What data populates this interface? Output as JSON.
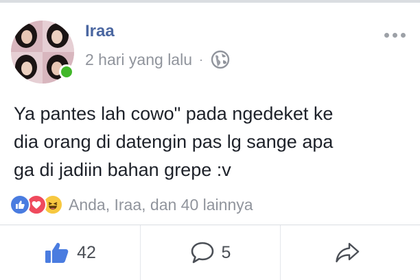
{
  "post": {
    "author": "Iraa",
    "timestamp": "2 hari yang lalu",
    "separator": "·",
    "privacy_icon": "globe-icon",
    "text": "Ya pantes lah cowo\" pada ngedeket ke\ndia orang di datengin pas lg sange apa\nga di jadiin bahan grepe :v",
    "reactions": {
      "icons": [
        "like-reaction-icon",
        "love-reaction-icon",
        "haha-reaction-icon"
      ],
      "summary": "Anda, Iraa, dan 40 lainnya"
    },
    "actions": {
      "like_count": "42",
      "comment_count": "5"
    }
  },
  "colors": {
    "author_name": "#4b67a1",
    "meta_text": "#90949c",
    "like_blue": "#4a7ce0",
    "love_red": "#ef4a5d",
    "haha_yellow": "#f7c840",
    "online_green": "#42b72a"
  }
}
